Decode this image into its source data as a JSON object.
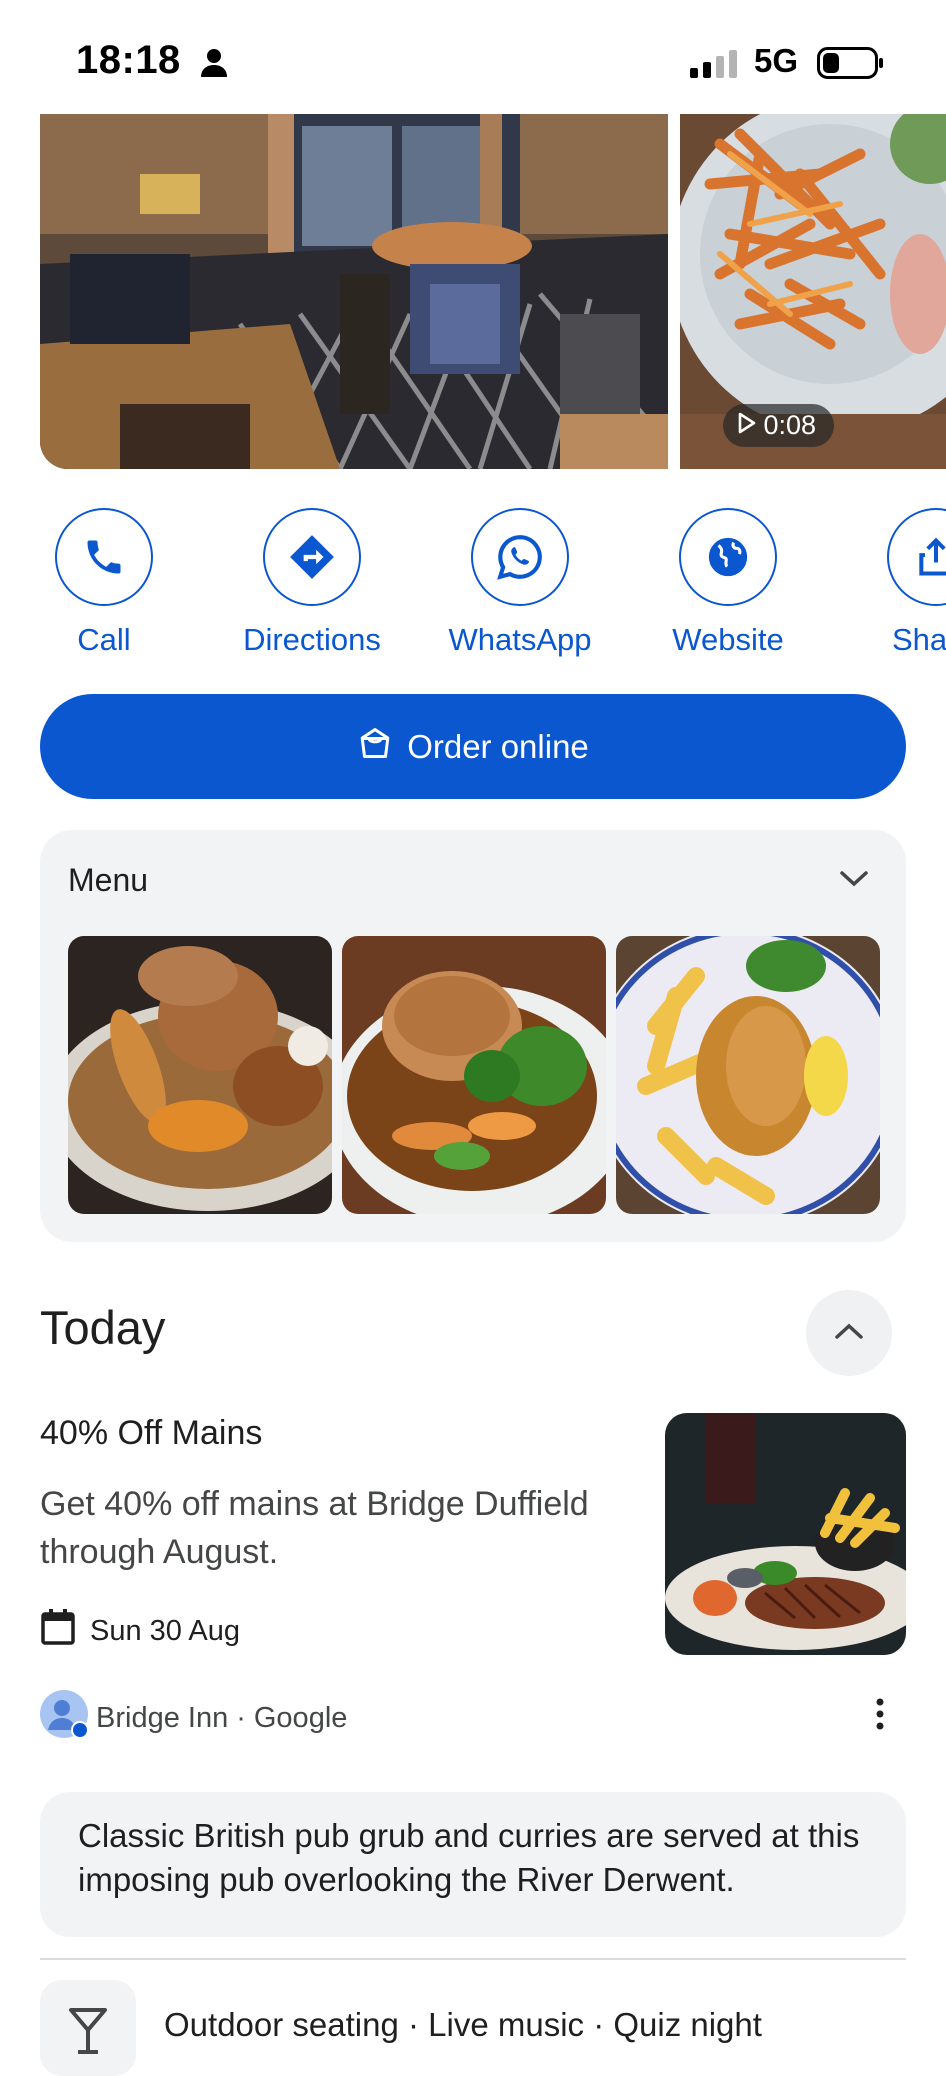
{
  "status_bar": {
    "time": "18:18",
    "network": "5G"
  },
  "media": {
    "video_duration": "0:08"
  },
  "actions": [
    {
      "label": "Call",
      "icon": "phone-icon"
    },
    {
      "label": "Directions",
      "icon": "directions-icon"
    },
    {
      "label": "WhatsApp",
      "icon": "whatsapp-icon"
    },
    {
      "label": "Website",
      "icon": "globe-icon"
    },
    {
      "label": "Sha",
      "icon": "share-icon"
    }
  ],
  "order_button": {
    "label": "Order online",
    "icon": "shopping-bag-icon"
  },
  "menu": {
    "title": "Menu"
  },
  "today": {
    "heading": "Today",
    "offer_title": "40% Off Mains",
    "offer_description": "Get 40% off mains at Bridge Duffield through August.",
    "date": "Sun 30 Aug",
    "poster_name": "Bridge Inn",
    "poster_source": "Google"
  },
  "description": "Classic British pub grub and curries are served at this imposing pub overlooking the River Derwent.",
  "amenities": "Outdoor seating · Live music · Quiz night",
  "colors": {
    "accent": "#0b57d0",
    "card_bg": "#f1f3f5"
  }
}
